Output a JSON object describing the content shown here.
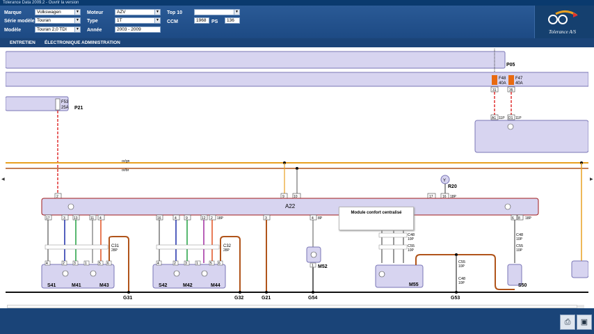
{
  "window": {
    "title": "Tolerance Data 2009.2 - Ouvrir la version"
  },
  "header": {
    "marque": {
      "label": "Marque",
      "value": "Volkswagen"
    },
    "serie": {
      "label": "Série modèle",
      "value": "Touran"
    },
    "modele": {
      "label": "Modèle",
      "value": "Touran 2,0 TDI"
    },
    "moteur": {
      "label": "Moteur",
      "value": "AZV"
    },
    "type": {
      "label": "Type",
      "value": "1T"
    },
    "annee": {
      "label": "Année",
      "value": "2003 - 2009"
    },
    "top10": {
      "label": "Top 10",
      "value": ""
    },
    "ccm": {
      "label": "CCM",
      "value": "1968"
    },
    "ps": {
      "label": "PS",
      "value": "136"
    },
    "logo_text": "Tolerance A/S"
  },
  "nav": [
    "ENTRETIEN",
    "ÉLECTRONIQUE",
    "ADMINISTRATION"
  ],
  "diagram": {
    "top_bar_label": "P05",
    "fuse_f48": [
      "F48",
      "40A"
    ],
    "fuse_f47": [
      "F47",
      "40A"
    ],
    "fuse_f53": [
      "F53",
      "25A"
    ],
    "p21": "P21",
    "pins_31": "31",
    "pins_35": "35",
    "a1": "A1",
    "d1": "D1",
    "p11_a": "11P",
    "p11_b": "11P",
    "a22": "A22",
    "r20": "R20",
    "y_label": "Y",
    "p18_main": "18P",
    "p18_right": "18P",
    "pin17": "17",
    "pin16": "16",
    "pin2": "2",
    "pin9": "9",
    "pin10": "10",
    "popup": "Module confort centralisé",
    "c31": [
      "C31",
      "28P"
    ],
    "c32": [
      "C32",
      "28P"
    ],
    "s41": "S41",
    "m41": "M41",
    "m43": "M43",
    "s42": "S42",
    "m42": "M42",
    "m44": "M44",
    "m52": "M52",
    "m55": "M55",
    "s50": "S50",
    "g31": "G31",
    "g32": "G32",
    "g21": "G21",
    "g54": "G54",
    "g53": "G53",
    "c48_a": [
      "C48",
      "10P"
    ],
    "c55_a": [
      "C55",
      "10P"
    ],
    "c55_b": [
      "C55",
      "10P"
    ],
    "c48_b": [
      "C48",
      "10P"
    ],
    "c48_c": [
      "C48",
      "10P"
    ],
    "c55_c": [
      "C55",
      "10P"
    ],
    "p8": "8P",
    "wire_1": "or/gn",
    "wire_2": "or/br",
    "pin3": "3",
    "pin4": "4",
    "pin6": "6",
    "pin8": "8",
    "pin1": "1",
    "pin5": "5",
    "pin7": "7",
    "pin11": "11",
    "pin15": "15",
    "pin12": "12",
    "pinsA": [
      "17",
      "3",
      "13",
      "11",
      "4"
    ],
    "pinsB": [
      "16",
      "4",
      "9",
      "12",
      "2"
    ],
    "compA": [
      "4",
      "2",
      "3",
      "1",
      "5",
      "6"
    ],
    "compB": [
      "4",
      "2",
      "3",
      "1",
      "5",
      "6"
    ]
  },
  "colors": {
    "header": "#1d4a84",
    "box_fill": "#d7d4f0",
    "box_stroke": "#7a76b6",
    "wire_orange": "#e8a020",
    "wire_brown": "#b0541a",
    "wire_red": "#e03030",
    "fuse": "#e86a10"
  }
}
